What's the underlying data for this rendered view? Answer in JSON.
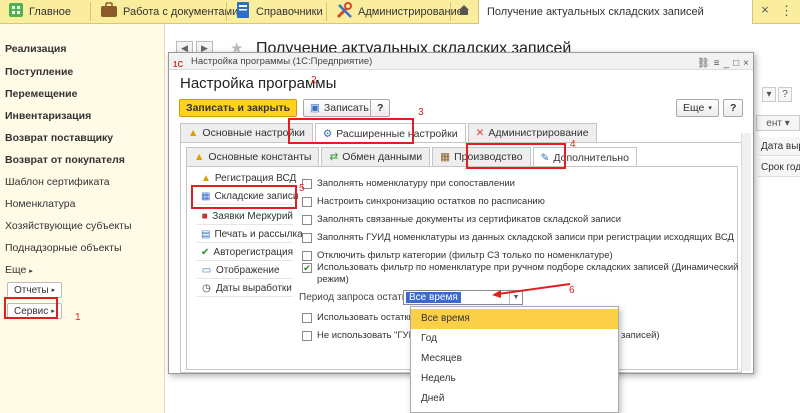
{
  "topbar": {
    "home": "Главное",
    "docs": "Работа с документами",
    "refs": "Справочники",
    "admin": "Администрирование",
    "tab_title": "Получение актуальных складских записей",
    "close": "×",
    "menu": "⋮"
  },
  "sidebar": {
    "items": [
      "Реализация",
      "Поступление",
      "Перемещение",
      "Инвентаризация",
      "Возврат поставщику",
      "Возврат от покупателя",
      "Шаблон сертификата",
      "Номенклатура",
      "Хозяйствующие субъекты",
      "Поднадзорные объекты",
      "Еще"
    ],
    "reports": "Отчеты",
    "service": "Сервис"
  },
  "background": {
    "title": "Получение актуальных складских записей",
    "right_more": "▾",
    "right_cell_1": "Дата выра",
    "right_cell_2": "Срок годн",
    "right_cell_3": "ент ▾"
  },
  "dialog": {
    "window_title": "Настройка программы (1С:Предприятие)",
    "heading": "Настройка программы",
    "save_close": "Записать и закрыть",
    "save": "Записать",
    "help": "?",
    "more": "Еще",
    "help2": "?",
    "tabs_main": [
      "Основные настройки",
      "Расширенные настройки",
      "Администрирование"
    ],
    "tabs_sub": [
      "Основные константы",
      "Обмен данными",
      "Производство",
      "Дополнительно"
    ],
    "side_items": [
      "Регистрация ВСД",
      "Складские записи",
      "Заявки Меркурий",
      "Печать и рассылка",
      "Авторегистрация",
      "Отображение",
      "Даты выработки"
    ],
    "checkboxes": [
      "Заполнять номенклатуру при сопоставлении",
      "Настроить синхронизацию остатков по расписанию",
      "Заполнять связанные документы из сертификатов складской записи",
      "Заполнять ГУИД номенклатуры из данных складской записи при регистрации исходящих ВСД",
      "Отключить фильтр категории (фильтр СЗ только по номенклатуре)",
      "Использовать фильтр по номенклатуре при ручном подборе складских записей (Динамический",
      "режим)",
      "Использовать остатки п",
      "Не использовать \"ГУИД"
    ],
    "cb_tail": "записей)",
    "period_label": "Период запроса остатков:",
    "period_value": "Все время",
    "dropdown": [
      "Все время",
      "Год",
      "Месяцев",
      "Недель",
      "Дней"
    ]
  },
  "annotations": [
    "1",
    "2",
    "3",
    "4",
    "5",
    "6"
  ],
  "colors": {
    "topbar": "#fbed9e",
    "sidebar": "#fffbe6",
    "primary": "#ffd21e",
    "selected": "#fbd046",
    "annotation": "#e02020"
  }
}
